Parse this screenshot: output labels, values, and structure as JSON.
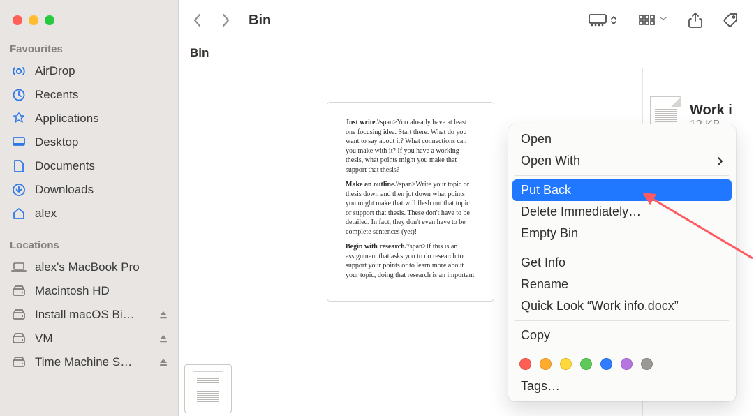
{
  "window": {
    "title": "Bin",
    "path": "Bin"
  },
  "sidebar": {
    "headers": {
      "fav": "Favourites",
      "loc": "Locations"
    },
    "fav": [
      {
        "label": "AirDrop",
        "icon": "airdrop"
      },
      {
        "label": "Recents",
        "icon": "clock"
      },
      {
        "label": "Applications",
        "icon": "apps"
      },
      {
        "label": "Desktop",
        "icon": "desktop"
      },
      {
        "label": "Documents",
        "icon": "doc"
      },
      {
        "label": "Downloads",
        "icon": "download"
      },
      {
        "label": "alex",
        "icon": "home"
      }
    ],
    "loc": [
      {
        "label": "alex's MacBook Pro",
        "icon": "laptop",
        "eject": false
      },
      {
        "label": "Macintosh HD",
        "icon": "disk",
        "eject": false
      },
      {
        "label": "Install macOS Bi…",
        "icon": "disk",
        "eject": true
      },
      {
        "label": "VM",
        "icon": "disk",
        "eject": true
      },
      {
        "label": "Time Machine S…",
        "icon": "disk",
        "eject": true
      }
    ]
  },
  "preview": {
    "p1b": "Just write.",
    "p1": "'/span>You already have at least one focusing idea. Start there. What do you want to say about it? What connections can you make with it? If you have a working thesis, what points might you make that support that thesis?",
    "p2b": "Make an outline.",
    "p2": "'/span>Write your topic or thesis down and then jot down what points you might make that will flesh out that topic or support that thesis. These don't have to be detailed. In fact, they don't even have to be complete sentences (yet)!",
    "p3b": "Begin with research.",
    "p3": "'/span>If this is an assignment that asks you to do research to support your points or to learn more about your topic, doing that research is an important"
  },
  "file": {
    "name": "Work i",
    "meta": "12 KB"
  },
  "menu": {
    "open": "Open",
    "openWith": "Open With",
    "putBack": "Put Back",
    "deleteImm": "Delete Immediately…",
    "emptyBin": "Empty Bin",
    "getInfo": "Get Info",
    "rename": "Rename",
    "quickLook": "Quick Look “Work info.docx”",
    "copy": "Copy",
    "tags": "Tags…",
    "tagColors": [
      "#ff5e55",
      "#ffab2e",
      "#ffd93b",
      "#5ec95a",
      "#2f7dff",
      "#b675e0",
      "#9a9996"
    ]
  }
}
